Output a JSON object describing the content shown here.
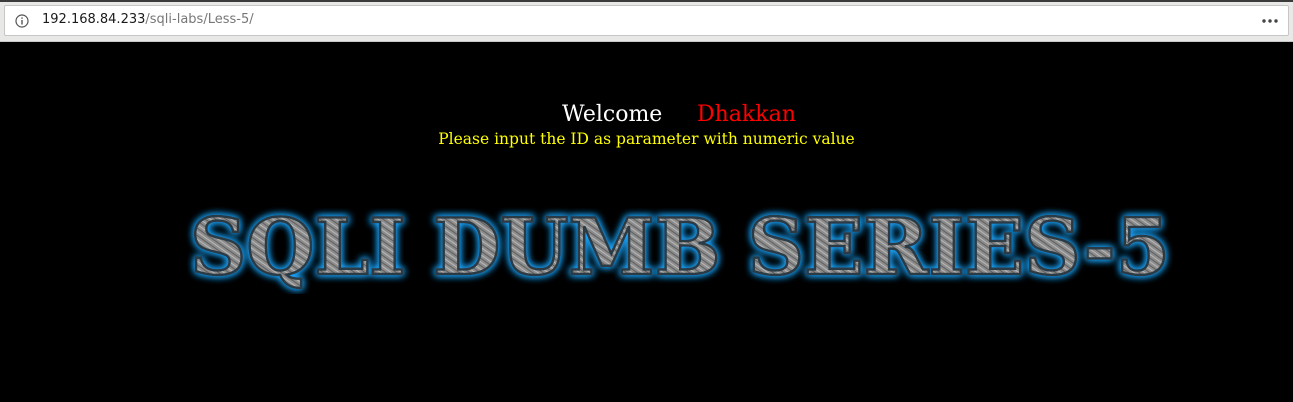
{
  "browser": {
    "url_host": "192.168.84.233",
    "url_path": "/sqli-labs/Less-5/",
    "info_icon": "info-icon",
    "menu_icon": "more-horizontal-icon"
  },
  "page": {
    "welcome_label": "Welcome",
    "welcome_name": "Dhakkan",
    "instruction": "Please input the ID as parameter with numeric value",
    "banner_title": "SQLI DUMB SERIES-5",
    "colors": {
      "background": "#000000",
      "welcome": "#ffffff",
      "name": "#ff0000",
      "instruction": "#ffff00",
      "banner_glow": "#1ea7ff",
      "banner_fill": "#8a8a8a"
    }
  }
}
